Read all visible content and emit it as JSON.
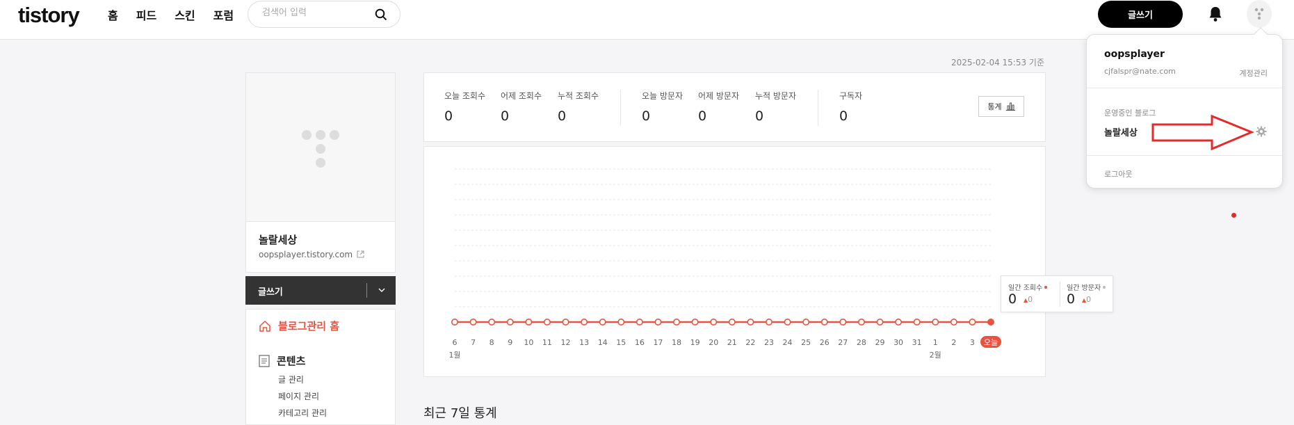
{
  "header": {
    "logo": "tistory",
    "nav": [
      "홈",
      "피드",
      "스킨",
      "포럼"
    ],
    "search_placeholder": "검색어 입력",
    "write_label": "글쓰기"
  },
  "timestamp": "2025-02-04 15:53 기준",
  "blog": {
    "name": "놀랄세상",
    "url": "oopsplayer.tistory.com"
  },
  "write_bar_label": "글쓰기",
  "menu": {
    "home_label": "블로그관리 홈",
    "contents_label": "콘텐츠",
    "sub_items": [
      "글 관리",
      "페이지 관리",
      "카테고리 관리"
    ]
  },
  "stats": [
    {
      "label": "오늘 조회수",
      "value": "0"
    },
    {
      "label": "어제 조회수",
      "value": "0"
    },
    {
      "label": "누적 조회수",
      "value": "0"
    },
    {
      "label": "오늘 방문자",
      "value": "0"
    },
    {
      "label": "어제 방문자",
      "value": "0"
    },
    {
      "label": "누적 방문자",
      "value": "0"
    },
    {
      "label": "구독자",
      "value": "0"
    }
  ],
  "stats_button_label": "통계",
  "chart_data": {
    "type": "line",
    "x": [
      "6",
      "7",
      "8",
      "9",
      "10",
      "11",
      "12",
      "13",
      "14",
      "15",
      "16",
      "17",
      "18",
      "19",
      "20",
      "21",
      "22",
      "23",
      "24",
      "25",
      "26",
      "27",
      "28",
      "29",
      "30",
      "31",
      "1",
      "2",
      "3",
      "오늘"
    ],
    "month_labels": [
      {
        "at": 0,
        "text": "1월"
      },
      {
        "at": 26,
        "text": "2월"
      }
    ],
    "series": [
      {
        "values": [
          0,
          0,
          0,
          0,
          0,
          0,
          0,
          0,
          0,
          0,
          0,
          0,
          0,
          0,
          0,
          0,
          0,
          0,
          0,
          0,
          0,
          0,
          0,
          0,
          0,
          0,
          0,
          0,
          0,
          0
        ],
        "color": "#e8523f"
      }
    ],
    "grid": true,
    "ylim": [
      0,
      10
    ]
  },
  "tooltip": {
    "views_label": "일간 조회수",
    "views_value": "0",
    "views_change": "0",
    "visitors_label": "일간 방문자",
    "visitors_value": "0",
    "visitors_change": "0"
  },
  "section_title": "최근 7일 통계",
  "dropdown": {
    "username": "oopsplayer",
    "email": "cjfalspr@nate.com",
    "account_link": "계정관리",
    "section_label": "운영중인 블로그",
    "blog_name": "놀랄세상",
    "logout": "로그아웃"
  },
  "colors": {
    "accent": "#e8523f",
    "annotation_red": "#e62a2a"
  }
}
